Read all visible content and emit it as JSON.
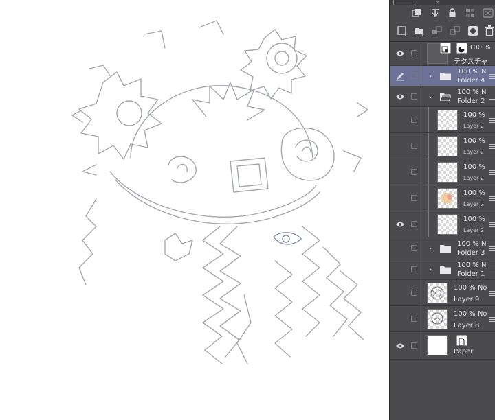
{
  "colors": {
    "panel_bg": "#4b4b4e",
    "selected_row": "#6c7196",
    "canvas_bg": "#ffffff",
    "sketch": "#8e939c"
  },
  "toolbar": {
    "row1_icons": [
      "layer-stack-icon",
      "transfer-icon",
      "lock-icon",
      "checker-lock-icon",
      "mask-icon"
    ],
    "row2_icons": [
      "new-raster-layer-icon",
      "new-folder-icon",
      "new-vector-layer-icon",
      "merge-layers-icon",
      "layer-mask-icon",
      "trash-icon"
    ]
  },
  "layers": [
    {
      "id": "texture",
      "percent": "100 %",
      "name": "テクスチャ",
      "visible": true,
      "indent": 0,
      "kind": "texture"
    },
    {
      "id": "folder4",
      "percent": "100 % N",
      "name": "Folder 4",
      "visible": false,
      "editing": true,
      "selected": true,
      "expanded": false,
      "indent": 0,
      "kind": "folder"
    },
    {
      "id": "folder2",
      "percent": "100 % N",
      "name": "Folder 2",
      "visible": true,
      "expanded": true,
      "indent": 0,
      "kind": "folder"
    },
    {
      "id": "l2a",
      "percent": "100 %",
      "name": "Layer 2",
      "visible": false,
      "indent": 1,
      "kind": "raster"
    },
    {
      "id": "l2b",
      "percent": "100 %",
      "name": "Layer 2",
      "visible": false,
      "indent": 1,
      "kind": "raster"
    },
    {
      "id": "l2c",
      "percent": "100 %",
      "name": "Layer 2",
      "visible": false,
      "indent": 1,
      "kind": "raster"
    },
    {
      "id": "l2d",
      "percent": "100 %",
      "name": "Layer 2",
      "visible": false,
      "indent": 1,
      "kind": "raster-color"
    },
    {
      "id": "l2e",
      "percent": "100 %",
      "name": "Layer 2",
      "visible": true,
      "indent": 1,
      "kind": "raster"
    },
    {
      "id": "folder3",
      "percent": "100 % N",
      "name": "Folder 3",
      "visible": false,
      "expanded": false,
      "indent": 0,
      "kind": "folder"
    },
    {
      "id": "folder1",
      "percent": "100 % N",
      "name": "Folder 1",
      "visible": false,
      "expanded": false,
      "indent": 0,
      "kind": "folder"
    },
    {
      "id": "layer9",
      "percent": "100 % No",
      "name": "Layer 9",
      "visible": false,
      "indent": 0,
      "kind": "raster-sketch"
    },
    {
      "id": "layer8",
      "percent": "100 % No",
      "name": "Layer 8",
      "visible": false,
      "indent": 0,
      "kind": "raster-sketch"
    },
    {
      "id": "paper",
      "percent": "",
      "name": "Paper",
      "visible": true,
      "indent": 0,
      "kind": "paper"
    }
  ]
}
